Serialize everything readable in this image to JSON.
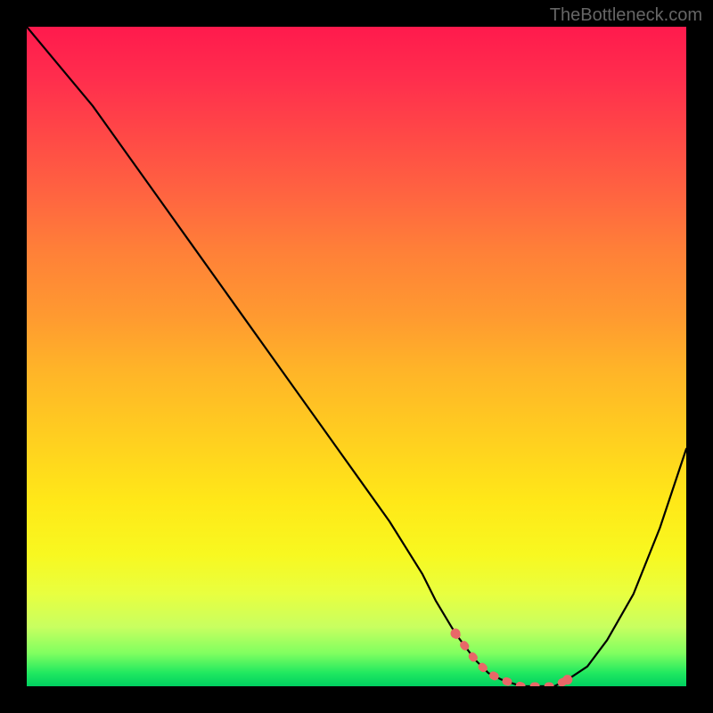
{
  "watermark": "TheBottleneck.com",
  "chart_data": {
    "type": "line",
    "title": "",
    "xlabel": "",
    "ylabel": "",
    "xlim": [
      0,
      100
    ],
    "ylim": [
      0,
      100
    ],
    "series": [
      {
        "name": "bottleneck-curve",
        "x": [
          0,
          5,
          10,
          15,
          20,
          25,
          30,
          35,
          40,
          45,
          50,
          55,
          60,
          62,
          65,
          68,
          70,
          72,
          75,
          78,
          80,
          82,
          85,
          88,
          92,
          96,
          100
        ],
        "values": [
          100,
          94,
          88,
          81,
          74,
          67,
          60,
          53,
          46,
          39,
          32,
          25,
          17,
          13,
          8,
          4,
          2,
          1,
          0,
          0,
          0,
          1,
          3,
          7,
          14,
          24,
          36
        ]
      }
    ],
    "optimal_zone": {
      "x_start": 63,
      "x_end": 82,
      "marker_color": "#e86868"
    },
    "background_gradient": {
      "top": "#ff1a4d",
      "mid": "#ffe818",
      "bottom": "#00d060"
    }
  }
}
